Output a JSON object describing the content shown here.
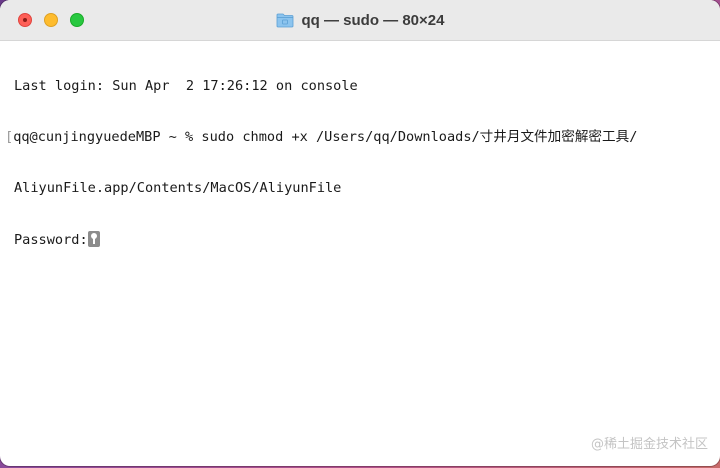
{
  "window": {
    "title": "qq — sudo — 80×24",
    "title_icon": "folder-icon"
  },
  "terminal": {
    "lines": [
      "Last login: Sun Apr  2 17:26:12 on console",
      "qq@cunjingyuedeMBP ~ % sudo chmod +x /Users/qq/Downloads/寸井月文件加密解密工具/",
      "AliyunFile.app/Contents/MacOS/AliyunFile",
      "Password:"
    ],
    "prompt_marker": "[",
    "cursor_icon": "key-icon"
  },
  "watermark": "@稀土掘金技术社区",
  "colors": {
    "close": "#fe5f57",
    "minimize": "#febc2e",
    "maximize": "#28c840"
  }
}
